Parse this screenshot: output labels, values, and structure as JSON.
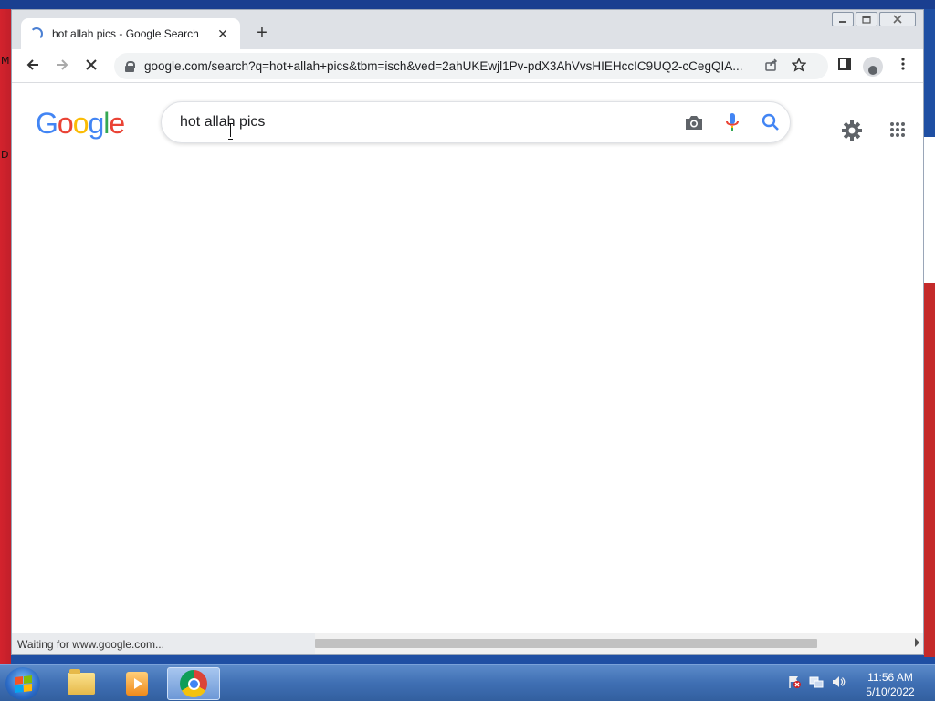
{
  "desktop": {
    "left_letters": [
      "M",
      "D"
    ]
  },
  "browser": {
    "tab": {
      "title": "hot allah pics - Google Search",
      "close": "✕"
    },
    "new_tab": "+",
    "nav": {
      "back": "←",
      "forward": "→",
      "reload": "✕"
    },
    "url": "google.com/search?q=hot+allah+pics&tbm=isch&ved=2ahUKEwjl1Pv-pdX3AhVvsHIEHccIC9UQ2-cCegQIA...",
    "status": "Waiting for www.google.com..."
  },
  "google": {
    "logo_letters": [
      "G",
      "o",
      "o",
      "g",
      "l",
      "e"
    ],
    "logo_colors": [
      "#4285F4",
      "#EA4335",
      "#FBBC05",
      "#4285F4",
      "#34A853",
      "#EA4335"
    ],
    "search_query": "hot allah pics"
  },
  "taskbar": {
    "clock_time": "11:56 AM",
    "clock_date": "5/10/2022",
    "apps": [
      "windows-explorer",
      "media-player",
      "chrome"
    ]
  },
  "colors": {
    "accent_blue": "#4285F4",
    "desktop_red": "#c21f2a",
    "taskbar_blue": "#3f6fb3"
  }
}
